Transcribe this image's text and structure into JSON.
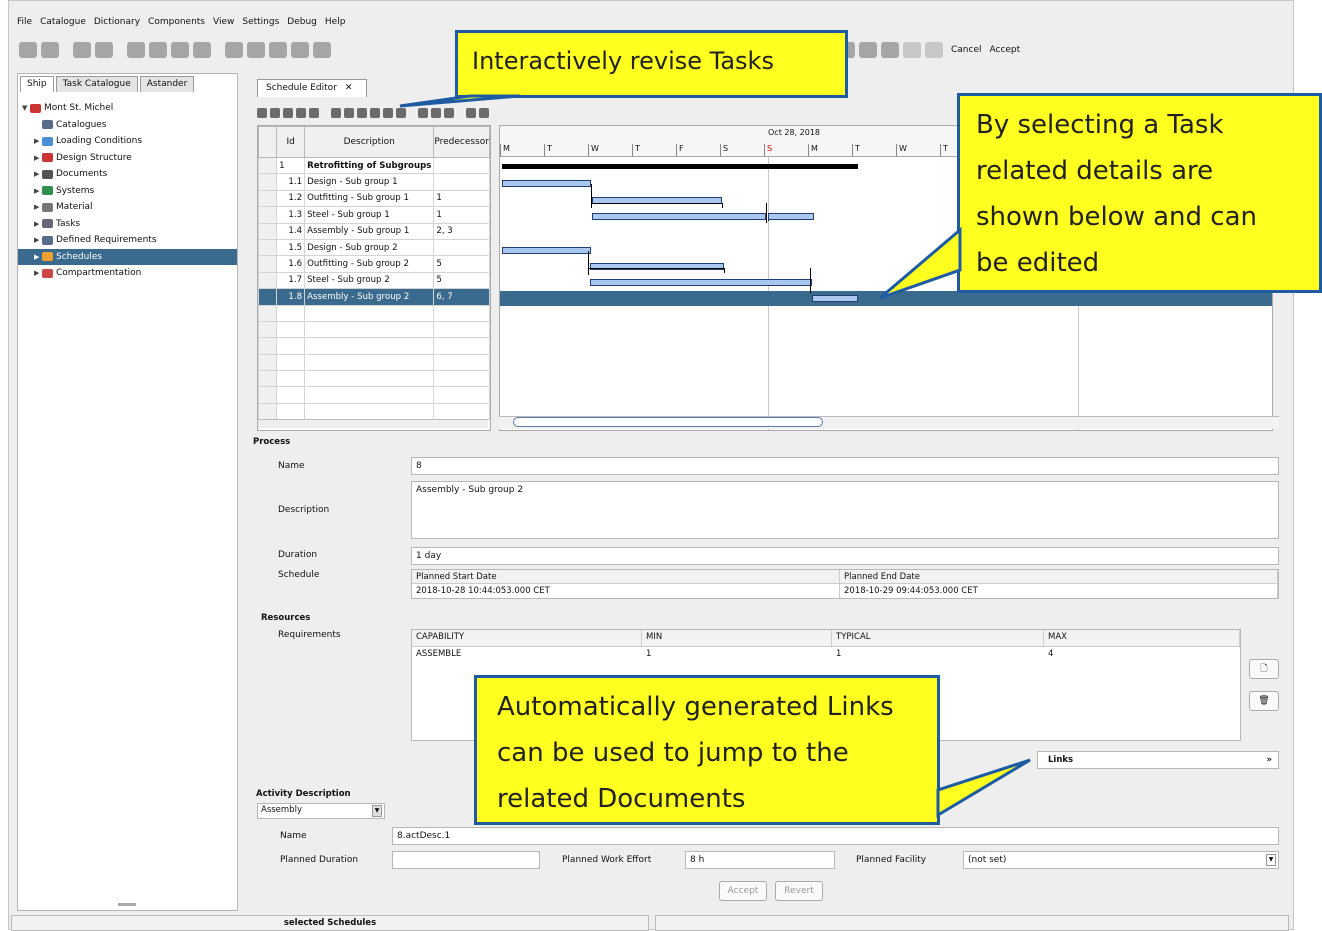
{
  "menu": [
    "File",
    "Catalogue",
    "Dictionary",
    "Components",
    "View",
    "Settings",
    "Debug",
    "Help"
  ],
  "toolbar": {
    "cancel": "Cancel",
    "accept": "Accept"
  },
  "left_tabs": [
    "Ship",
    "Task Catalogue",
    "Astander"
  ],
  "tree": [
    {
      "label": "Mont St. Michel",
      "level": 0,
      "arrow": "▼"
    },
    {
      "label": "Catalogues",
      "level": 1,
      "arrow": ""
    },
    {
      "label": "Loading Conditions",
      "level": 1,
      "arrow": "▶"
    },
    {
      "label": "Design Structure",
      "level": 1,
      "arrow": "▶"
    },
    {
      "label": "Documents",
      "level": 1,
      "arrow": "▶"
    },
    {
      "label": "Systems",
      "level": 1,
      "arrow": "▶"
    },
    {
      "label": "Material",
      "level": 1,
      "arrow": "▶"
    },
    {
      "label": "Tasks",
      "level": 1,
      "arrow": "▶"
    },
    {
      "label": "Defined Requirements",
      "level": 1,
      "arrow": "▶"
    },
    {
      "label": "Schedules",
      "level": 1,
      "arrow": "▶"
    },
    {
      "label": "Compartmentation",
      "level": 1,
      "arrow": "▶"
    }
  ],
  "editor_tab": "Schedule Editor",
  "grid": {
    "headers": [
      "Id",
      "Description",
      "Predecessor"
    ],
    "rows": [
      [
        "1",
        "Retrofitting of Subgroups",
        ""
      ],
      [
        "1.1",
        "Design - Sub group 1",
        ""
      ],
      [
        "1.2",
        "Outfitting - Sub group 1",
        "1"
      ],
      [
        "1.3",
        "Steel - Sub group 1",
        "1"
      ],
      [
        "1.4",
        "Assembly - Sub group 1",
        "2, 3"
      ],
      [
        "1.5",
        "Design - Sub group 2",
        ""
      ],
      [
        "1.6",
        "Outfitting - Sub group 2",
        "5"
      ],
      [
        "1.7",
        "Steel - Sub group 2",
        "5"
      ],
      [
        "1.8",
        "Assembly - Sub group 2",
        "6, 7"
      ]
    ]
  },
  "gantt": {
    "week_label": "Oct 28, 2018",
    "days": [
      "M",
      "T",
      "W",
      "T",
      "F",
      "S",
      "S",
      "M",
      "T",
      "W",
      "T"
    ]
  },
  "process": {
    "section": "Process",
    "name_label": "Name",
    "name_value": "8",
    "desc_label": "Description",
    "desc_value": "Assembly - Sub group 2",
    "duration_label": "Duration",
    "duration_value": "1 day",
    "schedule_label": "Schedule",
    "start_header": "Planned Start Date",
    "end_header": "Planned End Date",
    "start_value": "2018-10-28 10:44:053.000 CET",
    "end_value": "2018-10-29 09:44:053.000 CET"
  },
  "resources": {
    "section": "Resources",
    "req_label": "Requirements",
    "headers": [
      "CAPABILITY",
      "MIN",
      "TYPICAL",
      "MAX"
    ],
    "row": [
      "ASSEMBLE",
      "1",
      "1",
      "4"
    ],
    "links": "Links"
  },
  "activity": {
    "section": "Activity Description",
    "type": "Assembly",
    "name_label": "Name",
    "name_value": "8.actDesc.1",
    "dur_label": "Planned Duration",
    "dur_value": "",
    "work_label": "Planned Work Effort",
    "work_value": "8 h",
    "facility_label": "Planned Facility",
    "facility_value": "(not set)",
    "accept": "Accept",
    "revert": "Revert"
  },
  "status": {
    "left": "selected Schedules"
  },
  "callouts": {
    "revise": "Interactively revise Tasks",
    "select": [
      "By selecting a Task",
      "related details are",
      "shown below and can",
      "be edited"
    ],
    "links": [
      "Automatically generated Links",
      "can be used to jump to the",
      "related Documents"
    ]
  },
  "colors": {
    "selection": "#3a6a8d",
    "callout_fill": "#ffff20",
    "callout_border": "#1e5ba3",
    "bar": "#a9c7ef"
  }
}
